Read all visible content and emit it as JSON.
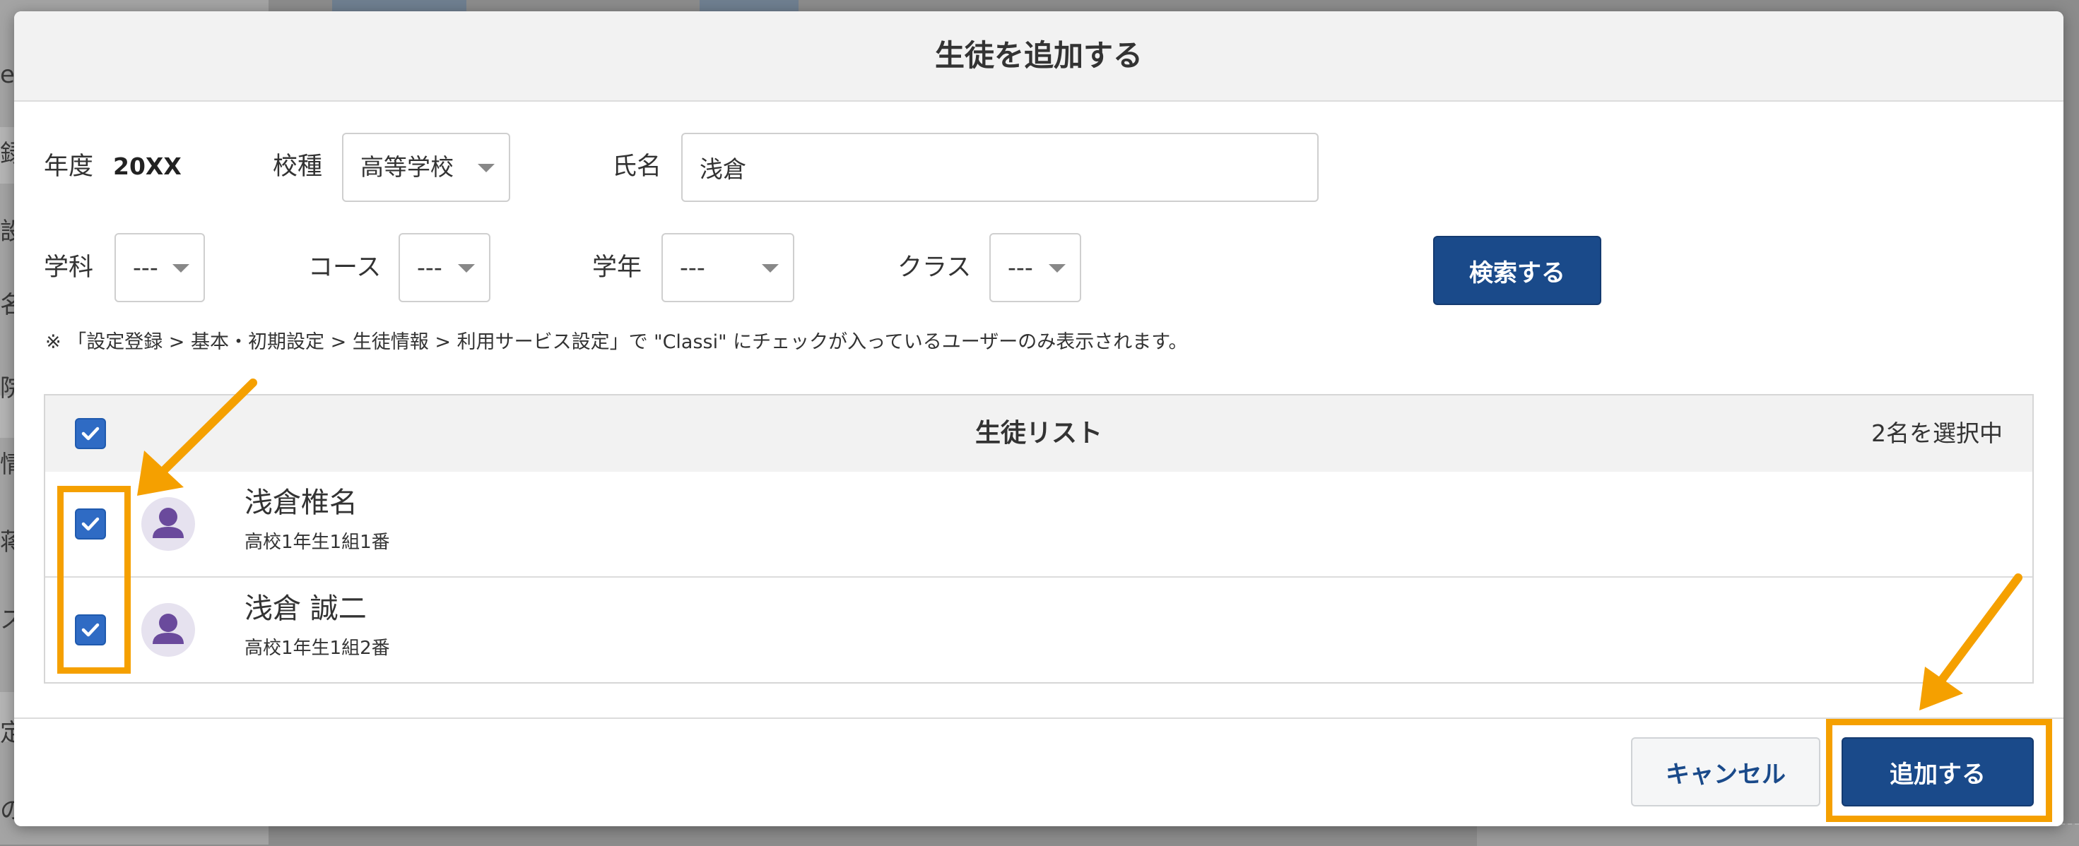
{
  "background": {
    "left_chars": [
      "e",
      "録",
      "設",
      "名",
      "院",
      "情",
      "蒋",
      "ス",
      "定",
      "の"
    ]
  },
  "modal": {
    "title": "生徒を追加する",
    "filters": {
      "year_label": "年度",
      "year_value": "20XX",
      "school_type_label": "校種",
      "school_type_value": "高等学校",
      "name_label": "氏名",
      "name_value": "浅倉",
      "department_label": "学科",
      "department_value": "---",
      "course_label": "コース",
      "course_value": "---",
      "grade_label": "学年",
      "grade_value": "---",
      "class_label": "クラス",
      "class_value": "---",
      "search_button": "検索する"
    },
    "note": "※ 「設定登録 > 基本・初期設定 > 生徒情報 > 利用サービス設定」で \"Classi\" にチェックが入っているユーザーのみ表示されます。",
    "student_list": {
      "title": "生徒リスト",
      "selected_count": "2名を選択中",
      "select_all_checked": true,
      "students": [
        {
          "name": "浅倉椎名",
          "meta": "高校1年生1組1番",
          "checked": true
        },
        {
          "name": "浅倉 誠二",
          "meta": "高校1年生1組2番",
          "checked": true
        }
      ]
    },
    "footer": {
      "cancel_button": "キャンセル",
      "add_button": "追加する"
    }
  },
  "colors": {
    "primary": "#1a4a8a",
    "checkbox": "#2f6bc4",
    "highlight": "#f5a000",
    "avatar": "#6a4a9c"
  }
}
